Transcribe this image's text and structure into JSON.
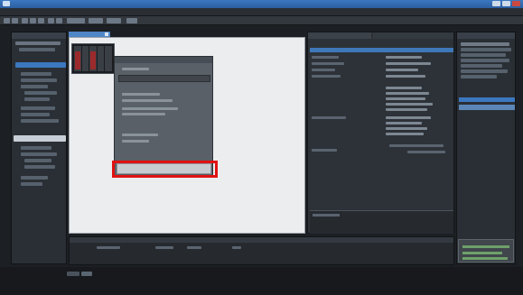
{
  "window": {
    "title": "",
    "controls": {
      "minimize": "",
      "maximize": "",
      "close": ""
    }
  },
  "menu": {
    "items": [
      "",
      "",
      "",
      "",
      "",
      "",
      "",
      "",
      "",
      ""
    ]
  },
  "toolbar": {
    "buttons": [
      "open-icon",
      "save-icon",
      "cut-icon",
      "copy-icon",
      "paste-icon",
      "undo-icon",
      "redo-icon",
      "build-icon",
      "online-icon",
      "transfer-icon",
      "settings-icon"
    ]
  },
  "left_panel": {
    "title": ""
  },
  "document": {
    "tab_label": "",
    "dialog": {
      "title": "",
      "highlighted_field_value": ""
    }
  },
  "properties": {
    "tabs": [
      "",
      ""
    ]
  },
  "toolbox": {
    "title": ""
  },
  "output": {
    "title": "",
    "columns": [
      "",
      "",
      "",
      ""
    ]
  },
  "colors": {
    "accent": "#3c78c2",
    "highlight": "#e01212",
    "background": "#1c1f23",
    "document": "#ecedef"
  }
}
